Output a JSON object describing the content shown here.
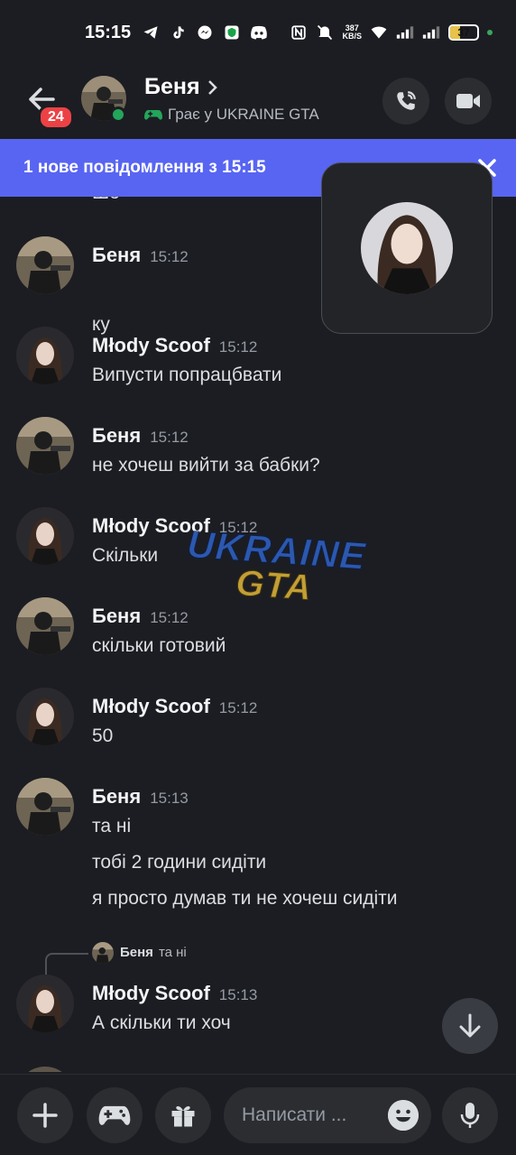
{
  "status_bar": {
    "time": "15:15",
    "speed_value": "387",
    "speed_unit": "KB/S",
    "battery": "37",
    "battery_level": 0.37
  },
  "header": {
    "unread_badge": "24",
    "name": "Беня",
    "activity": "Грає у UKRAINE GTA"
  },
  "banner": {
    "text": "1 нове повідомлення з 15:15"
  },
  "messages": [
    {
      "author": "",
      "time": "",
      "lines": [
        "Шо"
      ]
    },
    {
      "author": "Беня",
      "time": "15:12",
      "lines": [
        "ку"
      ]
    },
    {
      "author": "Młody Scoof",
      "time": "15:12",
      "lines": [
        "Випусти попрацбвати"
      ]
    },
    {
      "author": "Беня",
      "time": "15:12",
      "lines": [
        "не хочеш вийти за бабки?"
      ]
    },
    {
      "author": "Młody Scoof",
      "time": "15:12",
      "lines": [
        "Скільки"
      ]
    },
    {
      "author": "Беня",
      "time": "15:12",
      "lines": [
        "скільки готовий"
      ]
    },
    {
      "author": "Młody Scoof",
      "time": "15:12",
      "lines": [
        "50"
      ]
    },
    {
      "author": "Беня",
      "time": "15:13",
      "lines": [
        "та ні",
        "тобі 2 години сидіти",
        "я просто думав ти не хочеш сидіти"
      ]
    },
    {
      "author": "Młody Scoof",
      "time": "15:13",
      "lines": [
        "А скільки ти хоч"
      ],
      "reply": {
        "author": "Беня",
        "text": "та ні"
      }
    }
  ],
  "watermark": {
    "line1": "UKRAINE",
    "line2": "GTA"
  },
  "composer": {
    "placeholder": "Написати ..."
  },
  "colors": {
    "background": "#1c1d22",
    "accent": "#5865f2",
    "online": "#23a55a",
    "badge": "#ed4245"
  }
}
